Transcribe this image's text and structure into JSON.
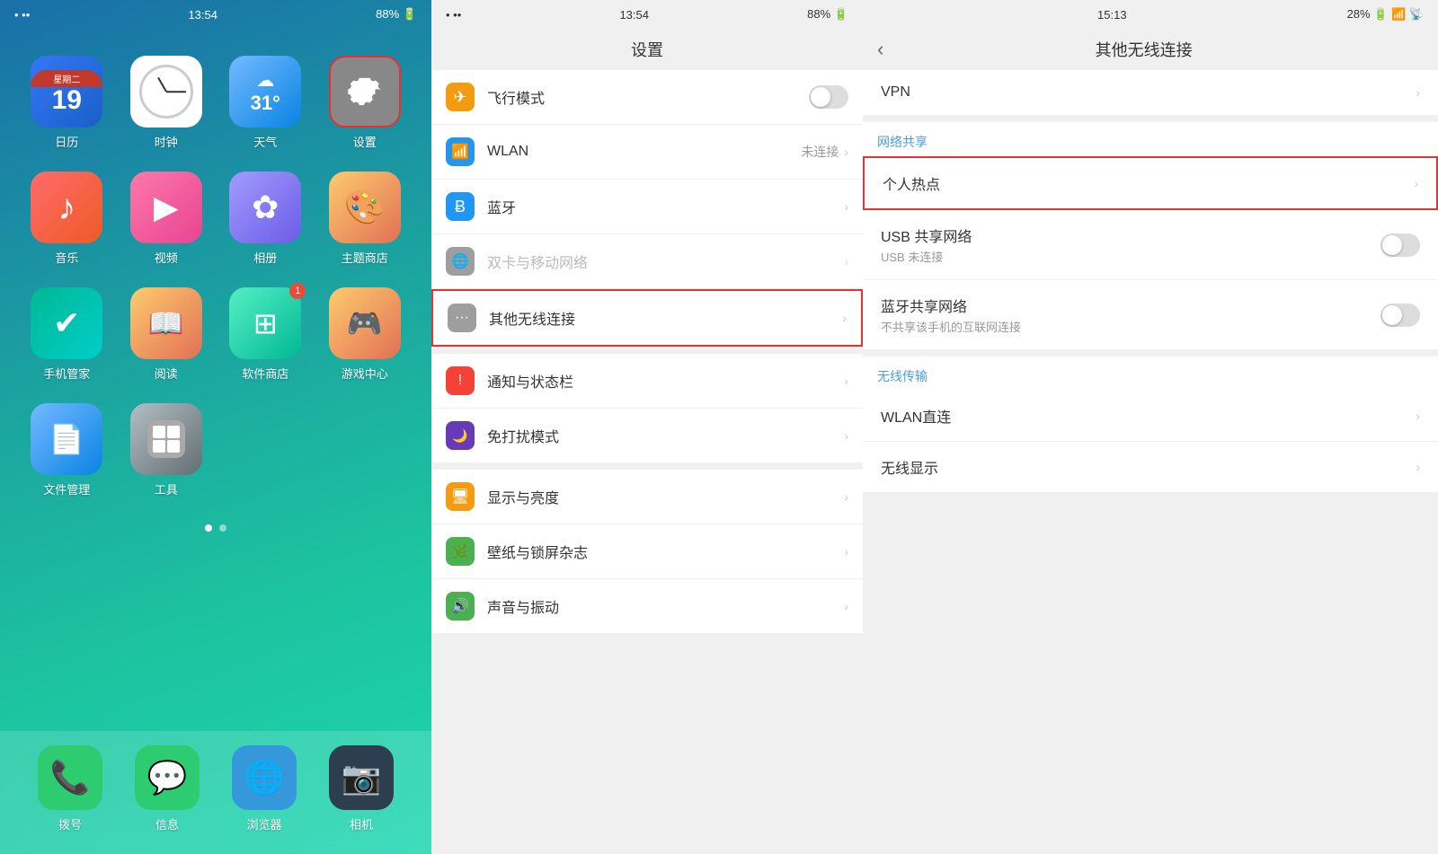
{
  "home_screen": {
    "status_bar": {
      "dots": "• ••",
      "time": "13:54",
      "battery": "88%",
      "signal_bars": "▌▌▌"
    },
    "apps": [
      {
        "id": "calendar",
        "label": "日历",
        "type": "calendar",
        "weekday": "星期二",
        "day": "19"
      },
      {
        "id": "clock",
        "label": "时钟",
        "type": "clock"
      },
      {
        "id": "weather",
        "label": "天气",
        "type": "weather",
        "temp": "31°"
      },
      {
        "id": "settings",
        "label": "设置",
        "type": "settings",
        "highlighted": true
      },
      {
        "id": "music",
        "label": "音乐",
        "type": "music",
        "icon": "♪"
      },
      {
        "id": "video",
        "label": "视频",
        "type": "video",
        "icon": "▶"
      },
      {
        "id": "photo",
        "label": "相册",
        "type": "photo",
        "icon": "✿"
      },
      {
        "id": "theme",
        "label": "主题商店",
        "type": "theme",
        "icon": "🎨"
      },
      {
        "id": "manager",
        "label": "手机管家",
        "type": "manager",
        "icon": "✔"
      },
      {
        "id": "reader",
        "label": "阅读",
        "type": "reader",
        "icon": "📖"
      },
      {
        "id": "software",
        "label": "软件商店",
        "type": "software",
        "icon": "⊞",
        "badge": "1"
      },
      {
        "id": "game",
        "label": "游戏中心",
        "type": "game",
        "icon": "🎮"
      },
      {
        "id": "file",
        "label": "文件管理",
        "type": "file",
        "icon": "📄"
      },
      {
        "id": "tools",
        "label": "工具",
        "type": "tools",
        "icon": "🔧"
      }
    ],
    "dock": [
      {
        "id": "phone",
        "label": "拨号",
        "icon": "📞",
        "color": "#2ecc71"
      },
      {
        "id": "messages",
        "label": "信息",
        "icon": "💬",
        "color": "#2ecc71"
      },
      {
        "id": "browser",
        "label": "浏览器",
        "icon": "🌐",
        "color": "#3498db"
      },
      {
        "id": "camera",
        "label": "相机",
        "icon": "📷",
        "color": "#2c3e50"
      }
    ]
  },
  "settings_panel": {
    "status_bar": {
      "dots": "• ••",
      "time": "13:54",
      "battery": "88%"
    },
    "title": "设置",
    "sections": [
      {
        "items": [
          {
            "id": "airplane",
            "label": "飞行模式",
            "icon_type": "airplane",
            "has_toggle": true,
            "toggle_on": false
          },
          {
            "id": "wlan",
            "label": "WLAN",
            "icon_type": "wifi",
            "value": "未连接",
            "has_chevron": true
          },
          {
            "id": "bluetooth",
            "label": "蓝牙",
            "icon_type": "bluetooth",
            "has_chevron": true
          },
          {
            "id": "simcard",
            "label": "双卡与移动网络",
            "icon_type": "simcard",
            "has_chevron": true,
            "disabled": true
          },
          {
            "id": "wireless",
            "label": "其他无线连接",
            "icon_type": "wireless",
            "has_chevron": true,
            "highlighted": true
          }
        ]
      },
      {
        "items": [
          {
            "id": "notify",
            "label": "通知与状态栏",
            "icon_type": "notify",
            "has_chevron": true
          },
          {
            "id": "dnd",
            "label": "免打扰模式",
            "icon_type": "dnd",
            "has_chevron": true
          }
        ]
      },
      {
        "items": [
          {
            "id": "display",
            "label": "显示与亮度",
            "icon_type": "display",
            "has_chevron": true
          },
          {
            "id": "wallpaper",
            "label": "壁纸与锁屏杂志",
            "icon_type": "wallpaper",
            "has_chevron": true
          },
          {
            "id": "sound",
            "label": "声音与振动",
            "icon_type": "sound",
            "has_chevron": true
          }
        ]
      }
    ]
  },
  "wireless_panel": {
    "status_bar": {
      "time": "15:13",
      "battery": "28%",
      "signal": "▌▌"
    },
    "back_label": "‹",
    "title": "其他无线连接",
    "sections": [
      {
        "items": [
          {
            "id": "vpn",
            "label": "VPN",
            "has_chevron": true
          }
        ]
      },
      {
        "section_label": "网络共享",
        "items": [
          {
            "id": "hotspot",
            "label": "个人热点",
            "has_chevron": true,
            "highlighted": true
          },
          {
            "id": "usb_share",
            "label": "USB 共享网络",
            "subtitle": "USB 未连接",
            "has_toggle": true,
            "toggle_on": false
          },
          {
            "id": "bt_share",
            "label": "蓝牙共享网络",
            "subtitle": "不共享该手机的互联网连接",
            "has_toggle": true,
            "toggle_on": false
          }
        ]
      },
      {
        "section_label": "无线传输",
        "items": [
          {
            "id": "wlan_direct",
            "label": "WLAN直连",
            "has_chevron": true
          },
          {
            "id": "wireless_display",
            "label": "无线显示",
            "has_chevron": true
          }
        ]
      }
    ]
  }
}
